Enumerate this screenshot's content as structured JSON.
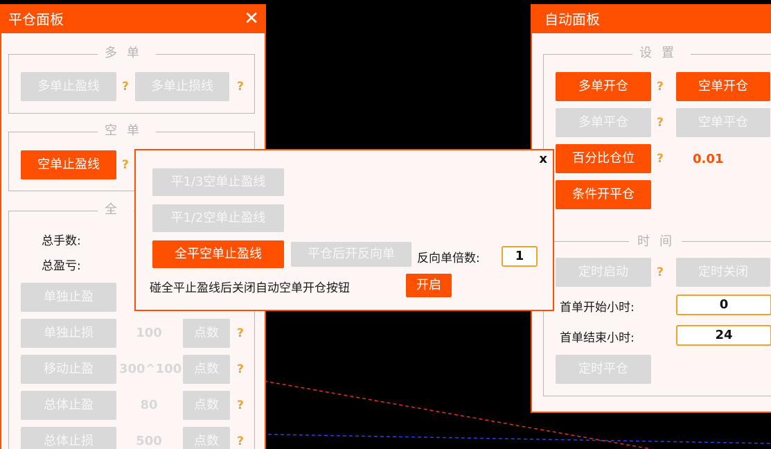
{
  "close_panel": {
    "title": "平仓面板",
    "close_glyph": "✕",
    "long_group": {
      "legend": "多单",
      "take_profit_label": "多单止盈线",
      "stop_loss_label": "多单止损线",
      "help": "?"
    },
    "short_group": {
      "legend": "空单",
      "take_profit_label": "空单止盈线",
      "help": "?"
    },
    "all_group": {
      "legend": "全",
      "total_lots_label": "总手数:",
      "total_pnl_label": "总盈亏:",
      "rows": [
        {
          "button": "单独止盈",
          "value": "",
          "unit": "",
          "help": ""
        },
        {
          "button": "单独止损",
          "value": "100",
          "unit": "点数",
          "help": "?"
        },
        {
          "button": "移动止盈",
          "value": "300^100",
          "unit": "点数",
          "help": "?"
        },
        {
          "button": "总体止盈",
          "value": "80",
          "unit": "点数",
          "help": "?"
        },
        {
          "button": "总体止损",
          "value": "500",
          "unit": "点数",
          "help": "?"
        }
      ]
    }
  },
  "popup": {
    "close_glyph": "x",
    "btn_third": "平1/3空单止盈线",
    "btn_half": "平1/2空单止盈线",
    "btn_all": "全平空单止盈线",
    "btn_reverse": "平仓后开反向单",
    "reverse_multiplier_label": "反向单倍数:",
    "reverse_multiplier_value": "1",
    "auto_close_text": "碰全平止盈线后关闭自动空单开仓按钮",
    "toggle_label": "开启"
  },
  "auto_panel": {
    "title": "自动面板",
    "settings_legend": "设置",
    "long_open": "多单开仓",
    "short_open": "空单开仓",
    "long_close": "多单平仓",
    "short_close": "空单平仓",
    "percent_position": "百分比仓位",
    "percent_value": "0.01",
    "conditional": "条件开平仓",
    "help": "?",
    "time_title": "时间",
    "timer_start": "定时启动",
    "timer_stop": "定时关闭",
    "first_start_label": "首单开始小时:",
    "first_start_value": "0",
    "first_end_label": "首单结束小时:",
    "first_end_value": "24",
    "timer_close": "定时平仓"
  },
  "colors": {
    "accent": "#ff4f00",
    "help": "#f2a227",
    "red_line": "#e5302a",
    "blue_line": "#2b3ff0"
  }
}
